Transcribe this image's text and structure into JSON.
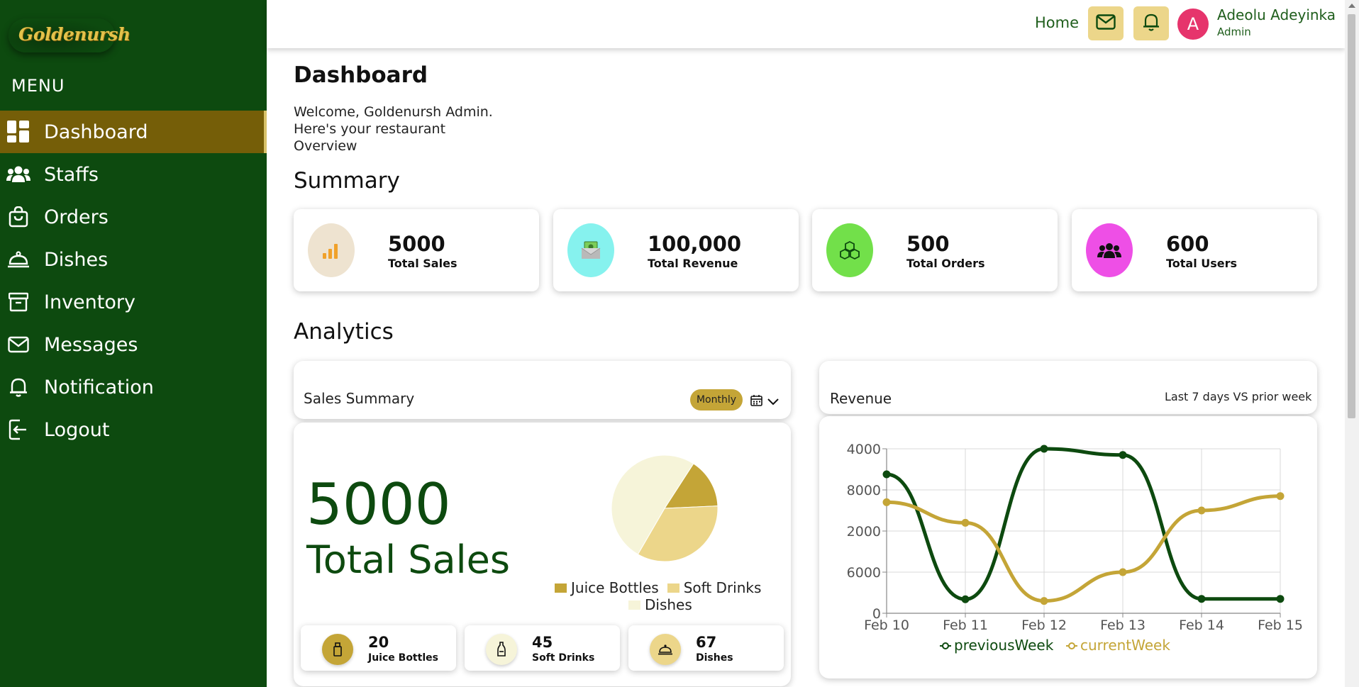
{
  "app": {
    "logo_text": "Goldenursh"
  },
  "sidebar": {
    "menu_title": "MENU",
    "items": [
      {
        "label": "Dashboard",
        "icon": "dashboard-icon"
      },
      {
        "label": "Staffs",
        "icon": "users-icon"
      },
      {
        "label": "Orders",
        "icon": "shopping-bag-icon"
      },
      {
        "label": "Dishes",
        "icon": "cloche-icon"
      },
      {
        "label": "Inventory",
        "icon": "archive-icon"
      },
      {
        "label": "Messages",
        "icon": "mail-icon"
      },
      {
        "label": "Notification",
        "icon": "bell-icon"
      },
      {
        "label": "Logout",
        "icon": "logout-icon"
      }
    ],
    "active_index": 0
  },
  "header": {
    "home_label": "Home",
    "user": {
      "initial": "A",
      "name": "Adeolu Adeyinka",
      "role": "Admin"
    }
  },
  "page": {
    "title": "Dashboard",
    "welcome_lines": [
      "Welcome, Goldenursh Admin.",
      "Here's your restaurant",
      "Overview"
    ]
  },
  "summary": {
    "title": "Summary",
    "cards": [
      {
        "value": "5000",
        "label": "Total Sales",
        "icon": "bar-chart-icon",
        "color": "#eee3d0"
      },
      {
        "value": "100,000",
        "label": "Total Revenue",
        "icon": "money-envelope-icon",
        "color": "#86f2ee"
      },
      {
        "value": "500",
        "label": "Total Orders",
        "icon": "boxes-icon",
        "color": "#72e04a"
      },
      {
        "value": "600",
        "label": "Total Users",
        "icon": "group-icon",
        "color": "#ee4fe6"
      }
    ]
  },
  "analytics": {
    "title": "Analytics",
    "sales_summary": {
      "title": "Sales Summary",
      "period": "Monthly",
      "total_value": "5000",
      "total_label": "Total Sales",
      "items": [
        {
          "value": "20",
          "label": "Juice Bottles",
          "icon": "bottle-icon",
          "color": "#c4a537"
        },
        {
          "value": "45",
          "label": "Soft Drinks",
          "icon": "drink-bottle-icon",
          "color": "#f6f4d9"
        },
        {
          "value": "67",
          "label": "Dishes",
          "icon": "cloche-icon",
          "color": "#ecd68a"
        }
      ]
    },
    "revenue": {
      "title": "Revenue",
      "period_note": "Last 7 days VS prior week"
    }
  },
  "chart_data": [
    {
      "type": "pie",
      "title": "",
      "slices": [
        {
          "name": "Juice Bottles",
          "value": 20,
          "color": "#c4a537"
        },
        {
          "name": "Soft Drinks",
          "value": 45,
          "color": "#ecd68a"
        },
        {
          "name": "Dishes",
          "value": 67,
          "color": "#f6f4d9"
        }
      ],
      "legend": "bottom"
    },
    {
      "type": "line",
      "title": "",
      "categories": [
        "Feb 10",
        "Feb 11",
        "Feb 12",
        "Feb 13",
        "Feb 14",
        "Feb 15"
      ],
      "y_tick_labels": [
        "0",
        "6000",
        "2000",
        "8000",
        "4000"
      ],
      "ylim": [
        0,
        4
      ],
      "series": [
        {
          "name": "previousWeek",
          "color": "#0d4a0f",
          "values": [
            3.38,
            0.34,
            4.0,
            3.85,
            0.35,
            0.35
          ]
        },
        {
          "name": "currentWeek",
          "color": "#c4a537",
          "values": [
            2.7,
            2.2,
            0.3,
            1.0,
            2.5,
            2.85
          ]
        }
      ],
      "grid": true,
      "legend": "bottom"
    }
  ]
}
